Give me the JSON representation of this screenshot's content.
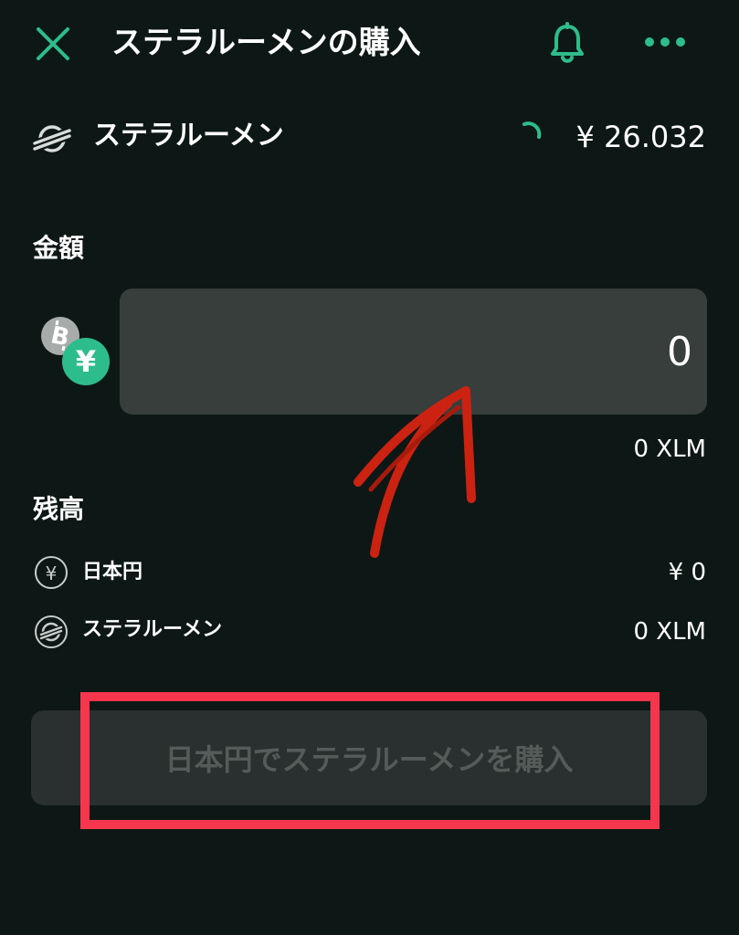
{
  "header": {
    "title": "ステラルーメンの購入",
    "close_icon": "close-icon",
    "notification_icon": "bell-icon",
    "more_icon": "more-dots-icon"
  },
  "coin": {
    "name": "ステラルーメン",
    "price": "¥ 26.032",
    "logo_icon": "stellar-logo-icon",
    "loading_icon": "refresh-spinner-icon"
  },
  "amount": {
    "label": "金額",
    "value": "0",
    "converted": "0 XLM",
    "currency_icons": [
      "bitcoin-icon",
      "yen-icon"
    ]
  },
  "balance": {
    "title": "残高",
    "items": [
      {
        "icon": "yen-icon",
        "label": "日本円",
        "value": "¥ 0"
      },
      {
        "icon": "stellar-logo-icon",
        "label": "ステラルーメン",
        "value": "0 XLM"
      }
    ]
  },
  "buy_button": {
    "label": "日本円でステラルーメンを購入",
    "enabled": false
  },
  "colors": {
    "background": "#0d1816",
    "accent": "#2dbd8c",
    "input_background": "#373e3c",
    "button_disabled_background": "#2a302f",
    "button_disabled_text": "#545b59",
    "annotation_box": "#f5364d",
    "annotation_arrow": "#cc2211"
  }
}
